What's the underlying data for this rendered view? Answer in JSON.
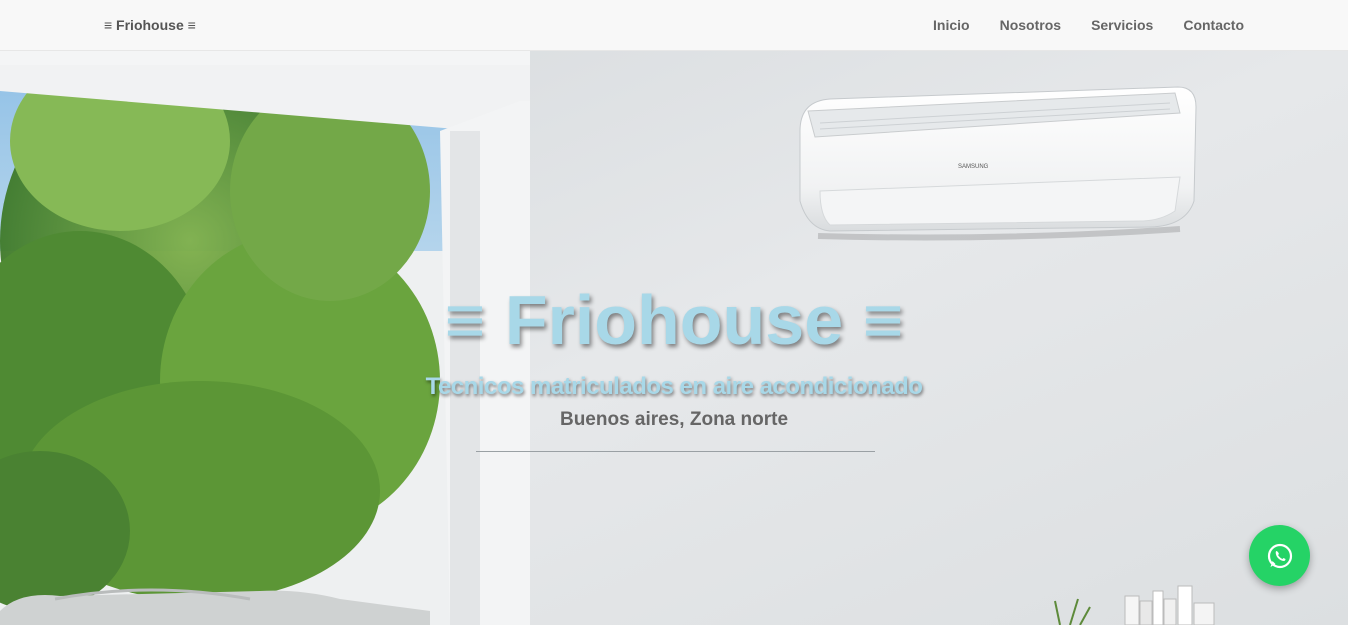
{
  "navbar": {
    "brand": "≡ Friohouse ≡",
    "links": [
      "Inicio",
      "Nosotros",
      "Servicios",
      "Contacto"
    ]
  },
  "hero": {
    "title": "≡ Friohouse ≡",
    "subtitle": "Tecnicos matriculados en aire acondicionado",
    "location": "Buenos aires, Zona norte",
    "ac_brand": "SAMSUNG"
  },
  "colors": {
    "accent": "#a8d8e8",
    "whatsapp": "#25d366",
    "navbar_bg": "#f8f8f8"
  },
  "icons": {
    "whatsapp": "whatsapp-icon"
  }
}
